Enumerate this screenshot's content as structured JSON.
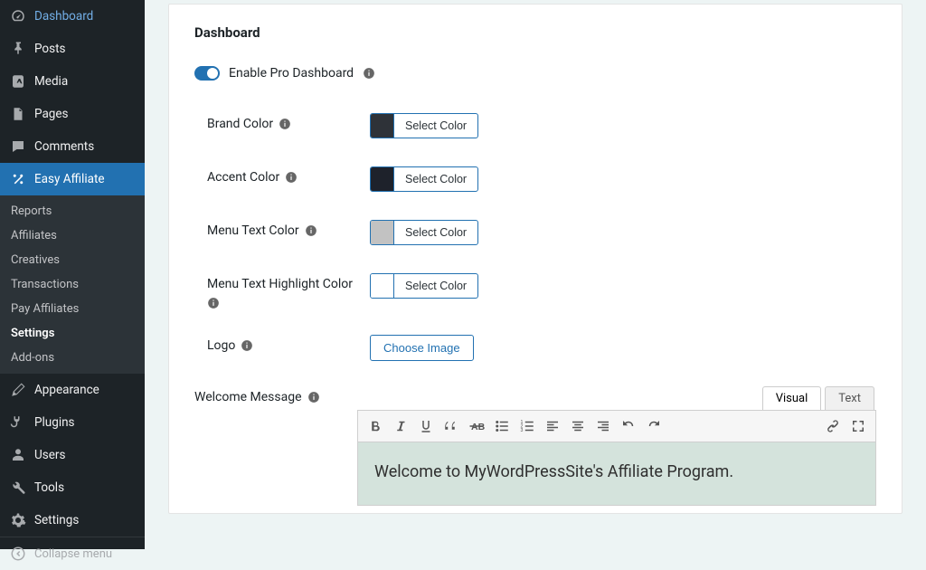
{
  "sidebar": {
    "top": [
      {
        "label": "Dashboard"
      },
      {
        "label": "Posts"
      },
      {
        "label": "Media"
      },
      {
        "label": "Pages"
      },
      {
        "label": "Comments"
      }
    ],
    "plugin": {
      "label": "Easy Affiliate"
    },
    "submenu": [
      {
        "label": "Reports"
      },
      {
        "label": "Affiliates"
      },
      {
        "label": "Creatives"
      },
      {
        "label": "Transactions"
      },
      {
        "label": "Pay Affiliates"
      },
      {
        "label": "Settings"
      },
      {
        "label": "Add-ons"
      }
    ],
    "bottom": [
      {
        "label": "Appearance"
      },
      {
        "label": "Plugins"
      },
      {
        "label": "Users"
      },
      {
        "label": "Tools"
      },
      {
        "label": "Settings"
      }
    ],
    "collapse": "Collapse menu"
  },
  "panel": {
    "title": "Dashboard",
    "enable_label": "Enable Pro Dashboard",
    "rows": {
      "brand_color": {
        "label": "Brand Color",
        "swatch": "#2e3238",
        "btn": "Select Color"
      },
      "accent_color": {
        "label": "Accent Color",
        "swatch": "#1e222b",
        "btn": "Select Color"
      },
      "menu_text_color": {
        "label": "Menu Text Color",
        "swatch": "#c2c2c2",
        "btn": "Select Color"
      },
      "menu_text_highlight": {
        "label": "Menu Text Highlight Color",
        "swatch": "#ffffff",
        "btn": "Select Color"
      },
      "logo": {
        "label": "Logo",
        "btn": "Choose Image"
      }
    },
    "welcome": {
      "label": "Welcome Message",
      "tabs": {
        "visual": "Visual",
        "text": "Text"
      },
      "content": "Welcome to MyWordPressSite's Affiliate Program."
    }
  }
}
